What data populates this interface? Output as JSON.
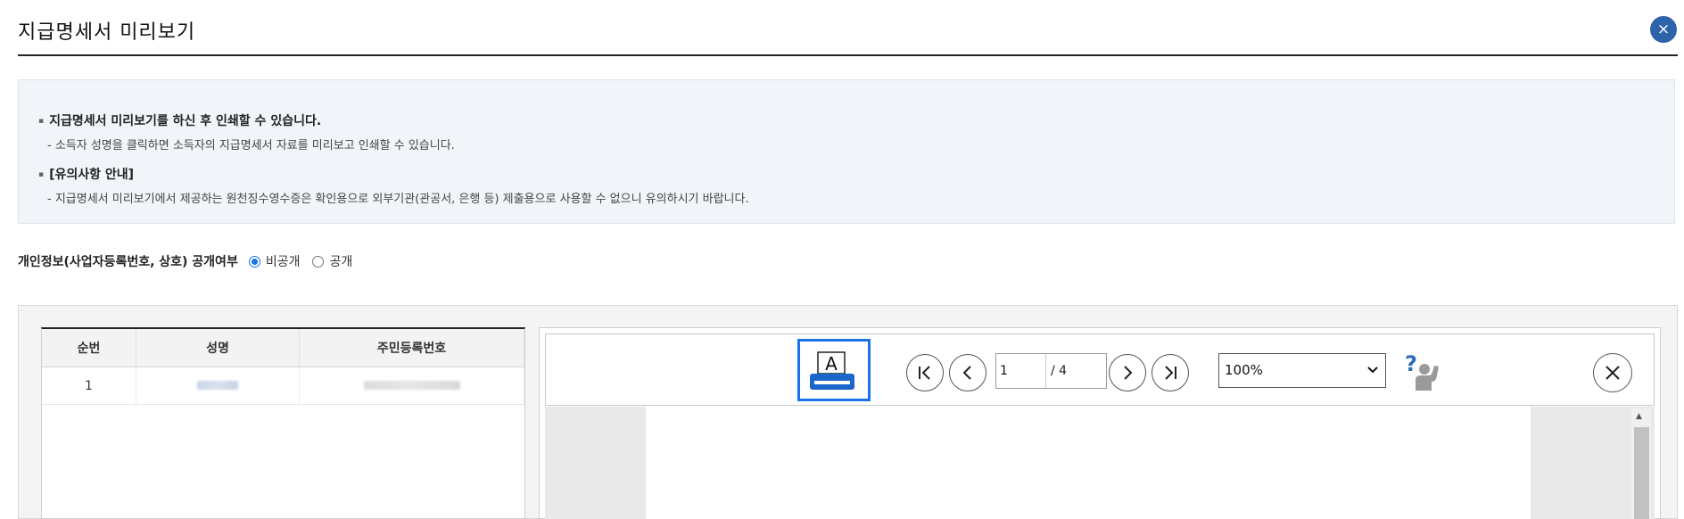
{
  "header": {
    "title": "지급명세서 미리보기",
    "close_glyph": "×"
  },
  "notice": {
    "items": [
      {
        "heading": "지급명세서 미리보기를 하신 후 인쇄할 수 있습니다.",
        "detail": "- 소득자 성명을 클릭하면 소득자의 지급명세서 자료를 미리보고 인쇄할 수 있습니다."
      },
      {
        "heading": "[유의사항 안내]",
        "detail": "- 지급명세서 미리보기에서 제공하는 원천징수영수증은 확인용으로 외부기관(관공서, 은행 등) 제출용으로 사용할 수 없으니 유의하시기 바랍니다."
      }
    ]
  },
  "privacy": {
    "label": "개인정보(사업자등록번호, 상호) 공개여부",
    "options": [
      {
        "label": "비공개",
        "selected": true
      },
      {
        "label": "공개",
        "selected": false
      }
    ]
  },
  "table": {
    "columns": [
      "순번",
      "성명",
      "주민등록번호"
    ],
    "rows": [
      {
        "no": "1"
      }
    ]
  },
  "viewer": {
    "print_label": "A",
    "page_current": "1",
    "page_total": "/ 4",
    "zoom": "100%",
    "accent_color": "#1a73e8"
  },
  "icons": [
    "close-icon",
    "printer-icon",
    "first-page-icon",
    "prev-page-icon",
    "next-page-icon",
    "last-page-icon",
    "chevron-down-icon",
    "help-icon"
  ]
}
